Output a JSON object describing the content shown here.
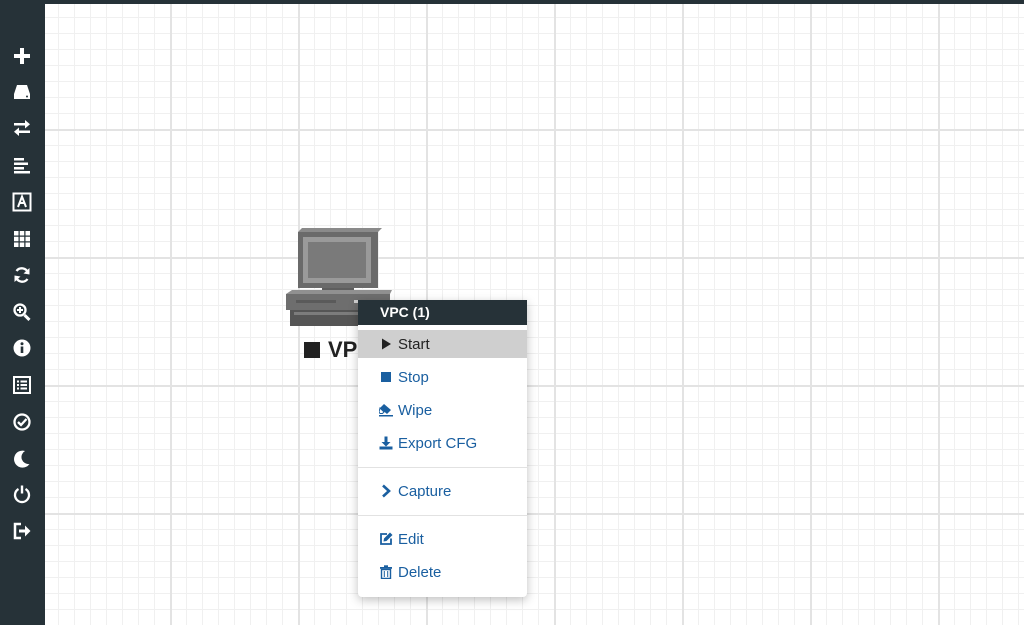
{
  "sidebar": {
    "buttons": [
      {
        "icon": "plus-icon"
      },
      {
        "icon": "hard-drive-icon"
      },
      {
        "icon": "exchange-icon"
      },
      {
        "icon": "align-left-icon"
      },
      {
        "icon": "text-font-icon"
      },
      {
        "icon": "grid-icon"
      },
      {
        "icon": "refresh-icon"
      },
      {
        "icon": "zoom-in-icon"
      },
      {
        "icon": "info-icon"
      },
      {
        "icon": "list-icon"
      },
      {
        "icon": "check-circle-icon"
      },
      {
        "icon": "moon-icon"
      },
      {
        "icon": "power-icon"
      },
      {
        "icon": "logout-icon"
      }
    ]
  },
  "canvas": {
    "node": {
      "label": "VP",
      "icon": "computer-icon",
      "status": "stopped"
    }
  },
  "context_menu": {
    "title": "VPC (1)",
    "items": [
      {
        "label": "Start",
        "icon": "play-icon",
        "active": true
      },
      {
        "label": "Stop",
        "icon": "stop-icon"
      },
      {
        "label": "Wipe",
        "icon": "eraser-icon"
      },
      {
        "label": "Export CFG",
        "icon": "download-icon"
      },
      {
        "label": "Capture",
        "icon": "chevron-right-icon"
      },
      {
        "label": "Edit",
        "icon": "edit-icon"
      },
      {
        "label": "Delete",
        "icon": "trash-icon"
      }
    ]
  },
  "colors": {
    "sidebar_bg": "#263238",
    "menu_header_bg": "#263238",
    "menu_link": "#1a5fa0",
    "menu_active_bg": "#cfcfcf",
    "grid_major": "#e3e3e3",
    "grid_minor": "#f0f0f0"
  }
}
